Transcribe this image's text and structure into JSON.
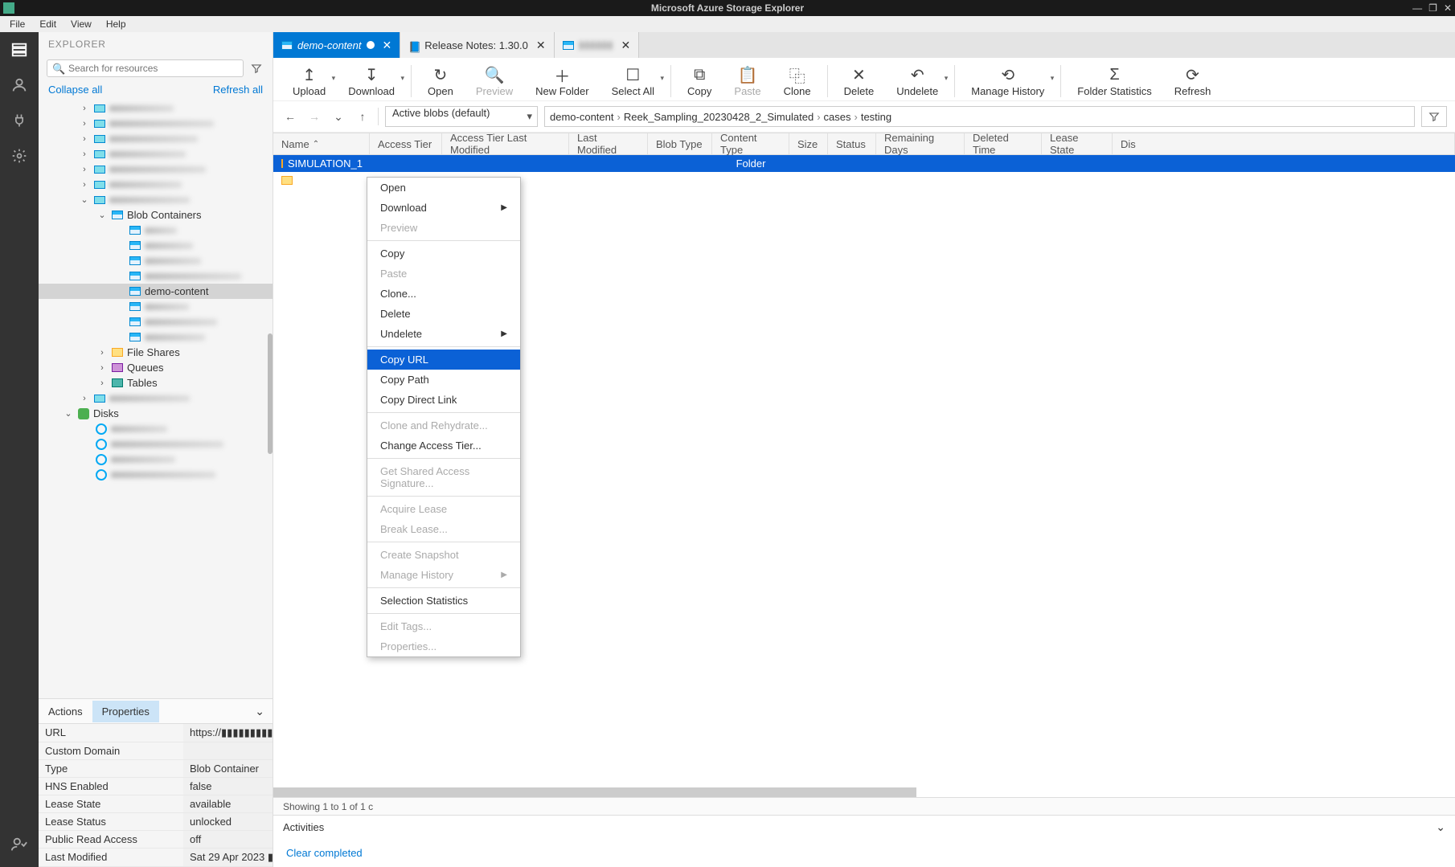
{
  "titlebar": {
    "title": "Microsoft Azure Storage Explorer"
  },
  "menubar": [
    "File",
    "Edit",
    "View",
    "Help"
  ],
  "explorer": {
    "header": "EXPLORER",
    "search_placeholder": "Search for resources",
    "collapse": "Collapse all",
    "refresh": "Refresh all",
    "blob_containers": "Blob Containers",
    "selected_container": "demo-content",
    "file_shares": "File Shares",
    "queues": "Queues",
    "tables": "Tables",
    "disks": "Disks"
  },
  "props_tabs": {
    "actions": "Actions",
    "properties": "Properties"
  },
  "properties": [
    {
      "k": "URL",
      "v": "https://▮▮▮▮▮▮▮▮▮"
    },
    {
      "k": "Custom Domain",
      "v": ""
    },
    {
      "k": "Type",
      "v": "Blob Container"
    },
    {
      "k": "HNS Enabled",
      "v": "false"
    },
    {
      "k": "Lease State",
      "v": "available"
    },
    {
      "k": "Lease Status",
      "v": "unlocked"
    },
    {
      "k": "Public Read Access",
      "v": "off"
    },
    {
      "k": "Last Modified",
      "v": "Sat 29 Apr 2023 ▮"
    }
  ],
  "tabs": [
    {
      "label": "demo-content",
      "active": true,
      "dirty": true
    },
    {
      "label": "Release Notes: 1.30.0",
      "active": false
    },
    {
      "label": "▮▮▮▮▮▮",
      "active": false,
      "blurred": true
    }
  ],
  "toolbar": {
    "upload": "Upload",
    "download": "Download",
    "open": "Open",
    "preview": "Preview",
    "new_folder": "New Folder",
    "select_all": "Select All",
    "copy": "Copy",
    "paste": "Paste",
    "clone": "Clone",
    "delete": "Delete",
    "undelete": "Undelete",
    "manage_history": "Manage History",
    "folder_stats": "Folder Statistics",
    "refresh": "Refresh"
  },
  "navbar": {
    "filter": "Active blobs (default)",
    "breadcrumb": [
      "demo-content",
      "Reek_Sampling_20230428_2_Simulated",
      "cases",
      "testing"
    ]
  },
  "grid": {
    "columns": [
      "Name",
      "Access Tier",
      "Access Tier Last Modified",
      "Last Modified",
      "Blob Type",
      "Content Type",
      "Size",
      "Status",
      "Remaining Days",
      "Deleted Time",
      "Lease State",
      "Dis"
    ],
    "rows": [
      {
        "name": "SIMULATION_1",
        "type": "Folder",
        "selected": true
      },
      {
        "name": "",
        "type": "",
        "selected": false
      }
    ],
    "status": "Showing 1 to 1 of 1 c"
  },
  "activities": {
    "label": "Activities",
    "clear": "Clear completed"
  },
  "context_menu": [
    {
      "label": "Open"
    },
    {
      "label": "Download",
      "submenu": true
    },
    {
      "label": "Preview",
      "disabled": true
    },
    {
      "sep": true
    },
    {
      "label": "Copy"
    },
    {
      "label": "Paste",
      "disabled": true
    },
    {
      "label": "Clone..."
    },
    {
      "label": "Delete"
    },
    {
      "label": "Undelete",
      "submenu": true
    },
    {
      "sep": true
    },
    {
      "label": "Copy URL",
      "hover": true
    },
    {
      "label": "Copy Path"
    },
    {
      "label": "Copy Direct Link"
    },
    {
      "sep": true
    },
    {
      "label": "Clone and Rehydrate...",
      "disabled": true
    },
    {
      "label": "Change Access Tier..."
    },
    {
      "sep": true
    },
    {
      "label": "Get Shared Access Signature...",
      "disabled": true
    },
    {
      "sep": true
    },
    {
      "label": "Acquire Lease",
      "disabled": true
    },
    {
      "label": "Break Lease...",
      "disabled": true
    },
    {
      "sep": true
    },
    {
      "label": "Create Snapshot",
      "disabled": true
    },
    {
      "label": "Manage History",
      "disabled": true,
      "submenu": true
    },
    {
      "sep": true
    },
    {
      "label": "Selection Statistics"
    },
    {
      "sep": true
    },
    {
      "label": "Edit Tags...",
      "disabled": true
    },
    {
      "label": "Properties...",
      "disabled": true
    }
  ]
}
